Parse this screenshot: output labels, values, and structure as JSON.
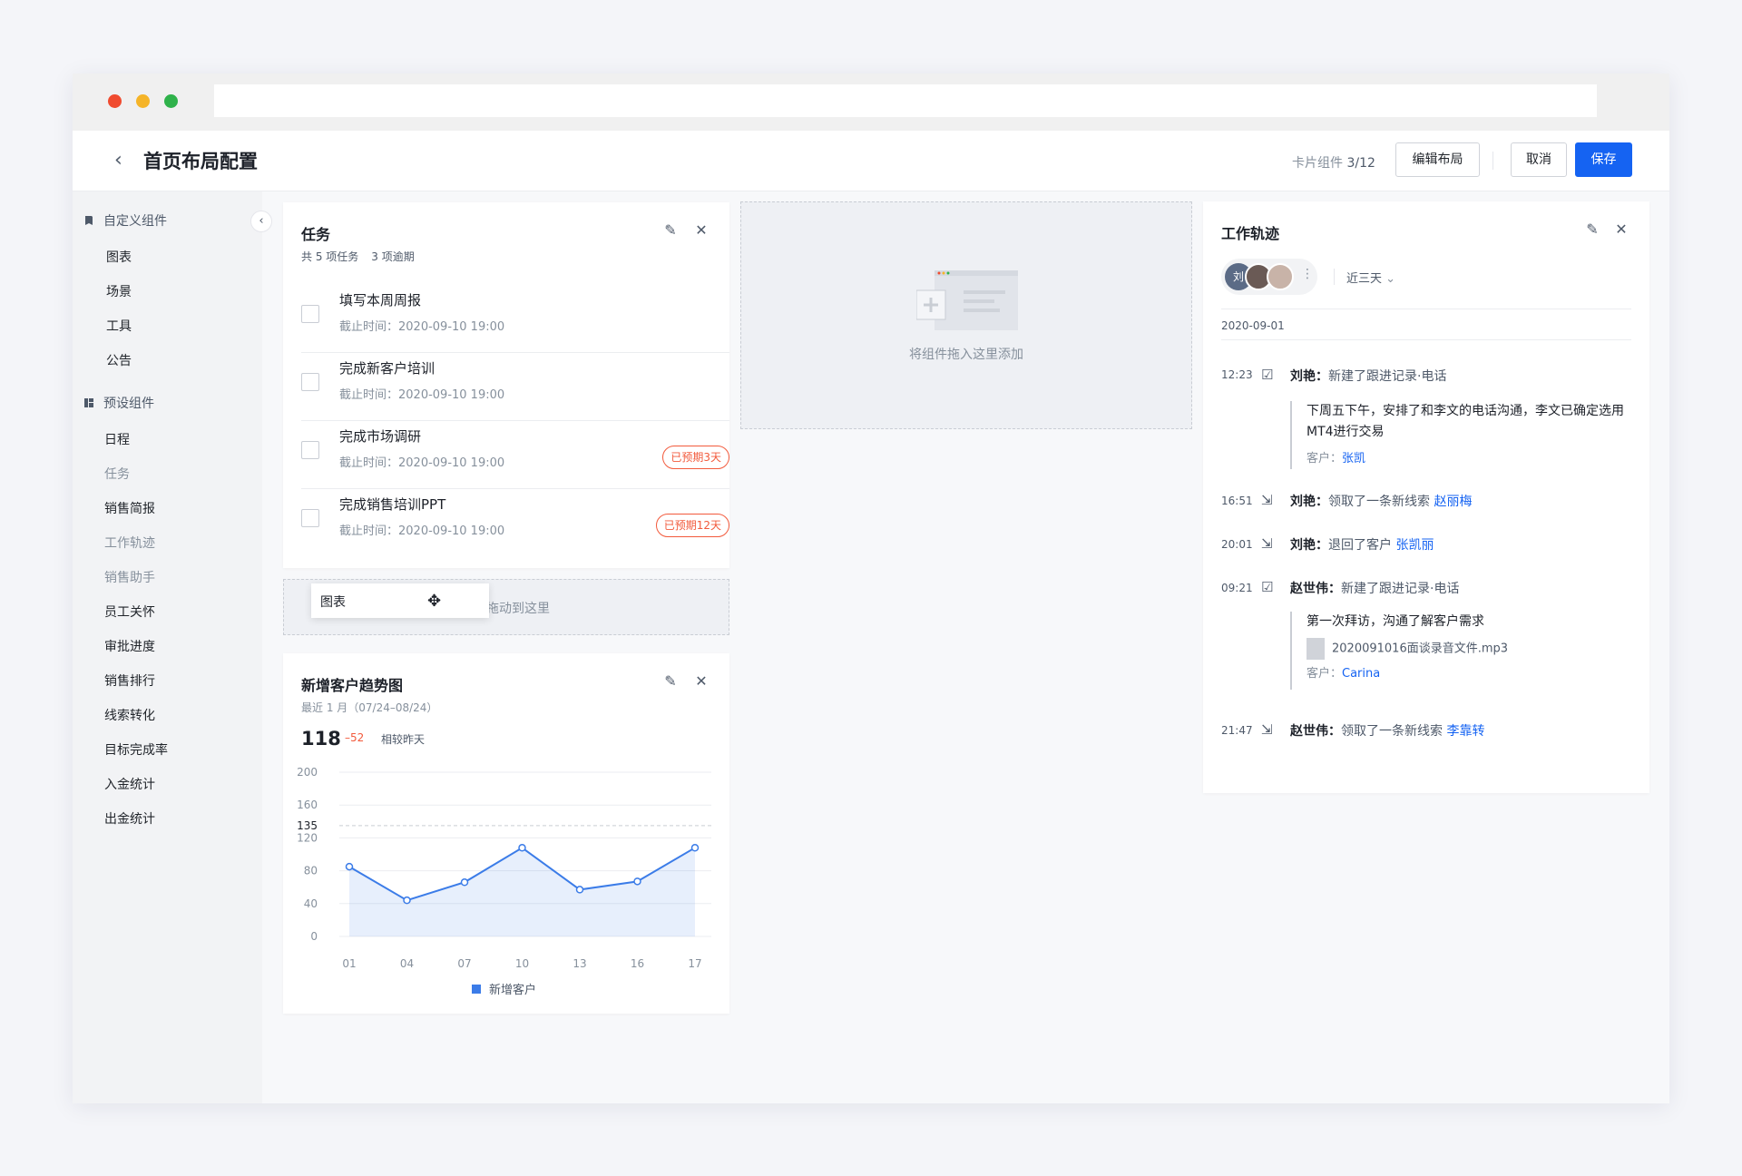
{
  "header": {
    "title": "首页布局配置",
    "card_count_label": "卡片组件",
    "card_count_value": "3/12",
    "edit_layout": "编辑布局",
    "cancel": "取消",
    "save": "保存"
  },
  "sidebar": {
    "custom_title": "自定义组件",
    "custom_items": [
      "图表",
      "场景",
      "工具",
      "公告"
    ],
    "preset_title": "预设组件",
    "preset_items": [
      {
        "label": "日程",
        "disabled": false
      },
      {
        "label": "任务",
        "disabled": true
      },
      {
        "label": "销售简报",
        "disabled": false
      },
      {
        "label": "工作轨迹",
        "disabled": true
      },
      {
        "label": "销售助手",
        "disabled": true
      },
      {
        "label": "员工关怀",
        "disabled": false
      },
      {
        "label": "审批进度",
        "disabled": false
      },
      {
        "label": "销售排行",
        "disabled": false
      },
      {
        "label": "线索转化",
        "disabled": false
      },
      {
        "label": "目标完成率",
        "disabled": false
      },
      {
        "label": "入金统计",
        "disabled": false
      },
      {
        "label": "出金统计",
        "disabled": false
      }
    ]
  },
  "tasks": {
    "title": "任务",
    "total": "共 5 项任务",
    "overdue_count": "3 项逾期",
    "items": [
      {
        "name": "填写本周周报",
        "due": "截止时间：2020-09-10 19:00",
        "badge": ""
      },
      {
        "name": "完成新客户培训",
        "due": "截止时间：2020-09-10 19:00",
        "badge": ""
      },
      {
        "name": "完成市场调研",
        "due": "截止时间：2020-09-10 19:00",
        "badge": "已预期3天"
      },
      {
        "name": "完成销售培训PPT",
        "due": "截止时间：2020-09-10 19:00",
        "badge": "已预期12天"
      }
    ]
  },
  "drag": {
    "card_label": "图表",
    "drop_hint": "拖动到这里",
    "empty_hint": "将组件拖入这里添加"
  },
  "trend": {
    "title": "新增客户趋势图",
    "subtitle": "最近 1 月（07/24–08/24）",
    "value": "118",
    "delta": "–52",
    "compare": "相较昨天"
  },
  "chart_data": {
    "type": "area",
    "categories": [
      "01",
      "04",
      "07",
      "10",
      "13",
      "16",
      "17"
    ],
    "series": [
      {
        "name": "新增客户",
        "values": [
          85,
          44,
          66,
          108,
          57,
          67,
          108
        ]
      }
    ],
    "ylim": [
      0,
      200
    ],
    "yticks": [
      "0",
      "40",
      "80",
      "120",
      "160",
      "200"
    ],
    "reference_line": {
      "value": 135,
      "label": "135"
    },
    "grid": true,
    "legend": "bottom",
    "color": "#3b7ce8"
  },
  "track": {
    "title": "工作轨迹",
    "avatar_text": "刘",
    "range": "近三天",
    "date": "2020-09-01",
    "events": [
      {
        "time": "12:23",
        "actor": "刘艳：",
        "action": "新建了跟进记录·电话",
        "note": "下周五下午，安排了和李文的电话沟通，李文已确定选用MT4进行交易",
        "customer_label": "客户：",
        "customer": "张凯"
      },
      {
        "time": "16:51",
        "actor": "刘艳：",
        "action": "领取了一条新线索",
        "link": "赵丽梅"
      },
      {
        "time": "20:01",
        "actor": "刘艳：",
        "action": "退回了客户",
        "link": "张凯丽"
      },
      {
        "time": "09:21",
        "actor": "赵世伟：",
        "action": "新建了跟进记录·电话",
        "note": "第一次拜访，沟通了解客户需求",
        "file": "2020091016面谈录音文件.mp3",
        "customer_label": "客户：",
        "customer": "Carina"
      },
      {
        "time": "21:47",
        "actor": "赵世伟：",
        "action": "领取了一条新线索",
        "link": "李靠转"
      }
    ]
  }
}
